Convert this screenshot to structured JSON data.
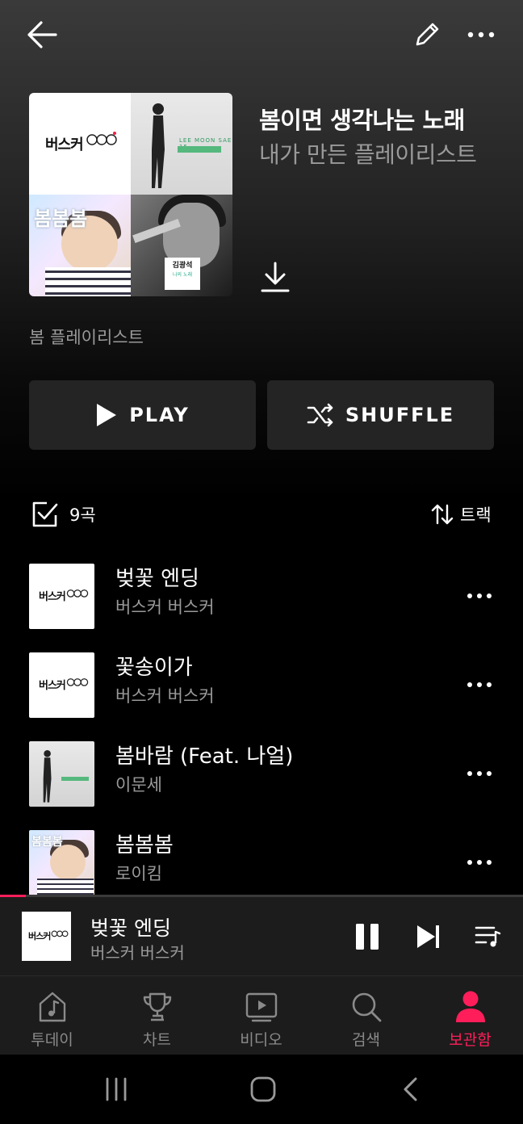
{
  "header": {
    "back_icon": "arrow-left-icon",
    "edit_icon": "pencil-icon",
    "more_icon": "more-horizontal-icon"
  },
  "playlist": {
    "title": "봄이면 생각나는 노래",
    "subtitle": "내가 만든 플레이리스트",
    "description": "봄 플레이리스트",
    "cover_texts": {
      "roykim_title": "봄봄봄",
      "kimkwangseok_title": "김광석",
      "kimkwangseok_sub": "나의 노래",
      "leemoonsae_line": "LEE MOON SAE 15"
    }
  },
  "actions": {
    "play_label": "PLAY",
    "shuffle_label": "SHUFFLE"
  },
  "list": {
    "count_label": "9곡",
    "sort_label": "트랙"
  },
  "tracks": [
    {
      "title": "벚꽃 엔딩",
      "artist": "버스커 버스커"
    },
    {
      "title": "꽃송이가",
      "artist": "버스커 버스커"
    },
    {
      "title": "봄바람 (Feat. 나얼)",
      "artist": "이문세"
    },
    {
      "title": "봄봄봄",
      "artist": "로이킴"
    }
  ],
  "now_playing": {
    "title": "벚꽃 엔딩",
    "artist": "버스커 버스커",
    "progress": 0.05
  },
  "nav": {
    "items": [
      {
        "label": "투데이",
        "icon": "music-note-icon"
      },
      {
        "label": "차트",
        "icon": "trophy-icon"
      },
      {
        "label": "비디오",
        "icon": "video-play-icon"
      },
      {
        "label": "검색",
        "icon": "search-icon"
      },
      {
        "label": "보관함",
        "icon": "user-icon"
      }
    ],
    "active_index": 4
  },
  "colors": {
    "accent": "#ff1e5a",
    "button_bg": "#242424",
    "muted_text": "#9a9a9a"
  }
}
